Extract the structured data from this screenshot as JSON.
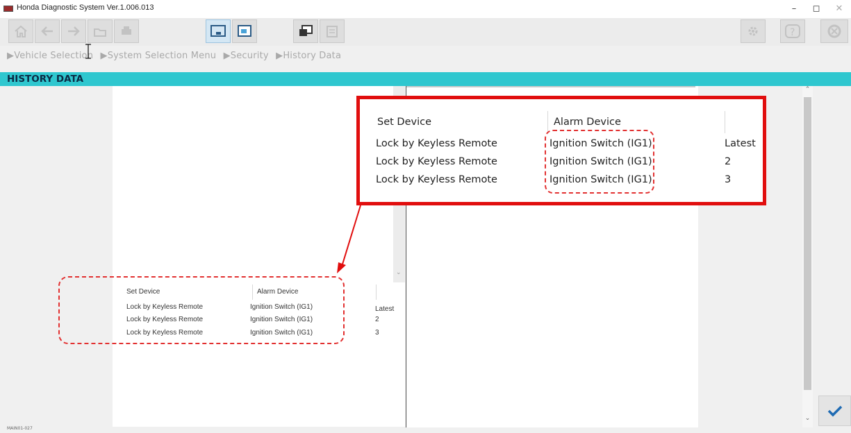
{
  "app": {
    "title": "Honda Diagnostic System Ver.1.006.013"
  },
  "window_controls": {
    "minimize": "–",
    "maximize": "◻",
    "close": "✕"
  },
  "toolbar": {
    "buttons": [
      {
        "icon": "home-icon"
      },
      {
        "icon": "back-arrow-icon"
      },
      {
        "icon": "forward-arrow-icon"
      },
      {
        "icon": "folder-icon"
      },
      {
        "icon": "print-icon"
      },
      {
        "icon": "screen-capture-icon",
        "active": true
      },
      {
        "icon": "window-icon"
      },
      {
        "icon": "multi-window-icon"
      },
      {
        "icon": "calculator-icon"
      },
      {
        "icon": "settings-icon"
      },
      {
        "icon": "help-icon"
      },
      {
        "icon": "exit-icon"
      }
    ]
  },
  "breadcrumb": [
    "Vehicle Selection",
    "System Selection Menu",
    "Security",
    "History Data"
  ],
  "page": {
    "title": "HISTORY DATA",
    "footer_code": "MAIN01-027"
  },
  "table": {
    "headers": {
      "set_device": "Set Device",
      "alarm_device": "Alarm Device"
    },
    "rows": [
      {
        "set_device": "Lock by Keyless Remote",
        "alarm_device": "Ignition Switch (IG1)",
        "index": "Latest"
      },
      {
        "set_device": "Lock by Keyless Remote",
        "alarm_device": "Ignition Switch (IG1)",
        "index": "2"
      },
      {
        "set_device": "Lock by Keyless Remote",
        "alarm_device": "Ignition Switch (IG1)",
        "index": "3"
      }
    ]
  },
  "colors": {
    "header_bar": "#2fc7cf",
    "callout_border": "#e10e0e",
    "check_icon": "#1f6bb3"
  }
}
